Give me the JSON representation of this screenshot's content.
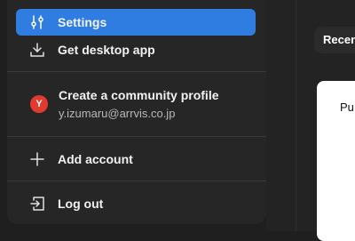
{
  "menu": {
    "settings_label": "Settings",
    "desktop_label": "Get desktop app",
    "profile": {
      "title": "Create a community profile",
      "email": "y.izumaru@arrvis.co.jp",
      "avatar_letter": "Y",
      "avatar_color": "#e23a2f"
    },
    "add_account_label": "Add account",
    "logout_label": "Log out"
  },
  "background": {
    "tab_label": "Recent",
    "card_text": "Pu"
  },
  "colors": {
    "active_highlight": "#2f7de0",
    "menu_bg": "#262626"
  },
  "icons": [
    "sliders-icon",
    "download-icon",
    "plus-icon",
    "logout-icon"
  ]
}
